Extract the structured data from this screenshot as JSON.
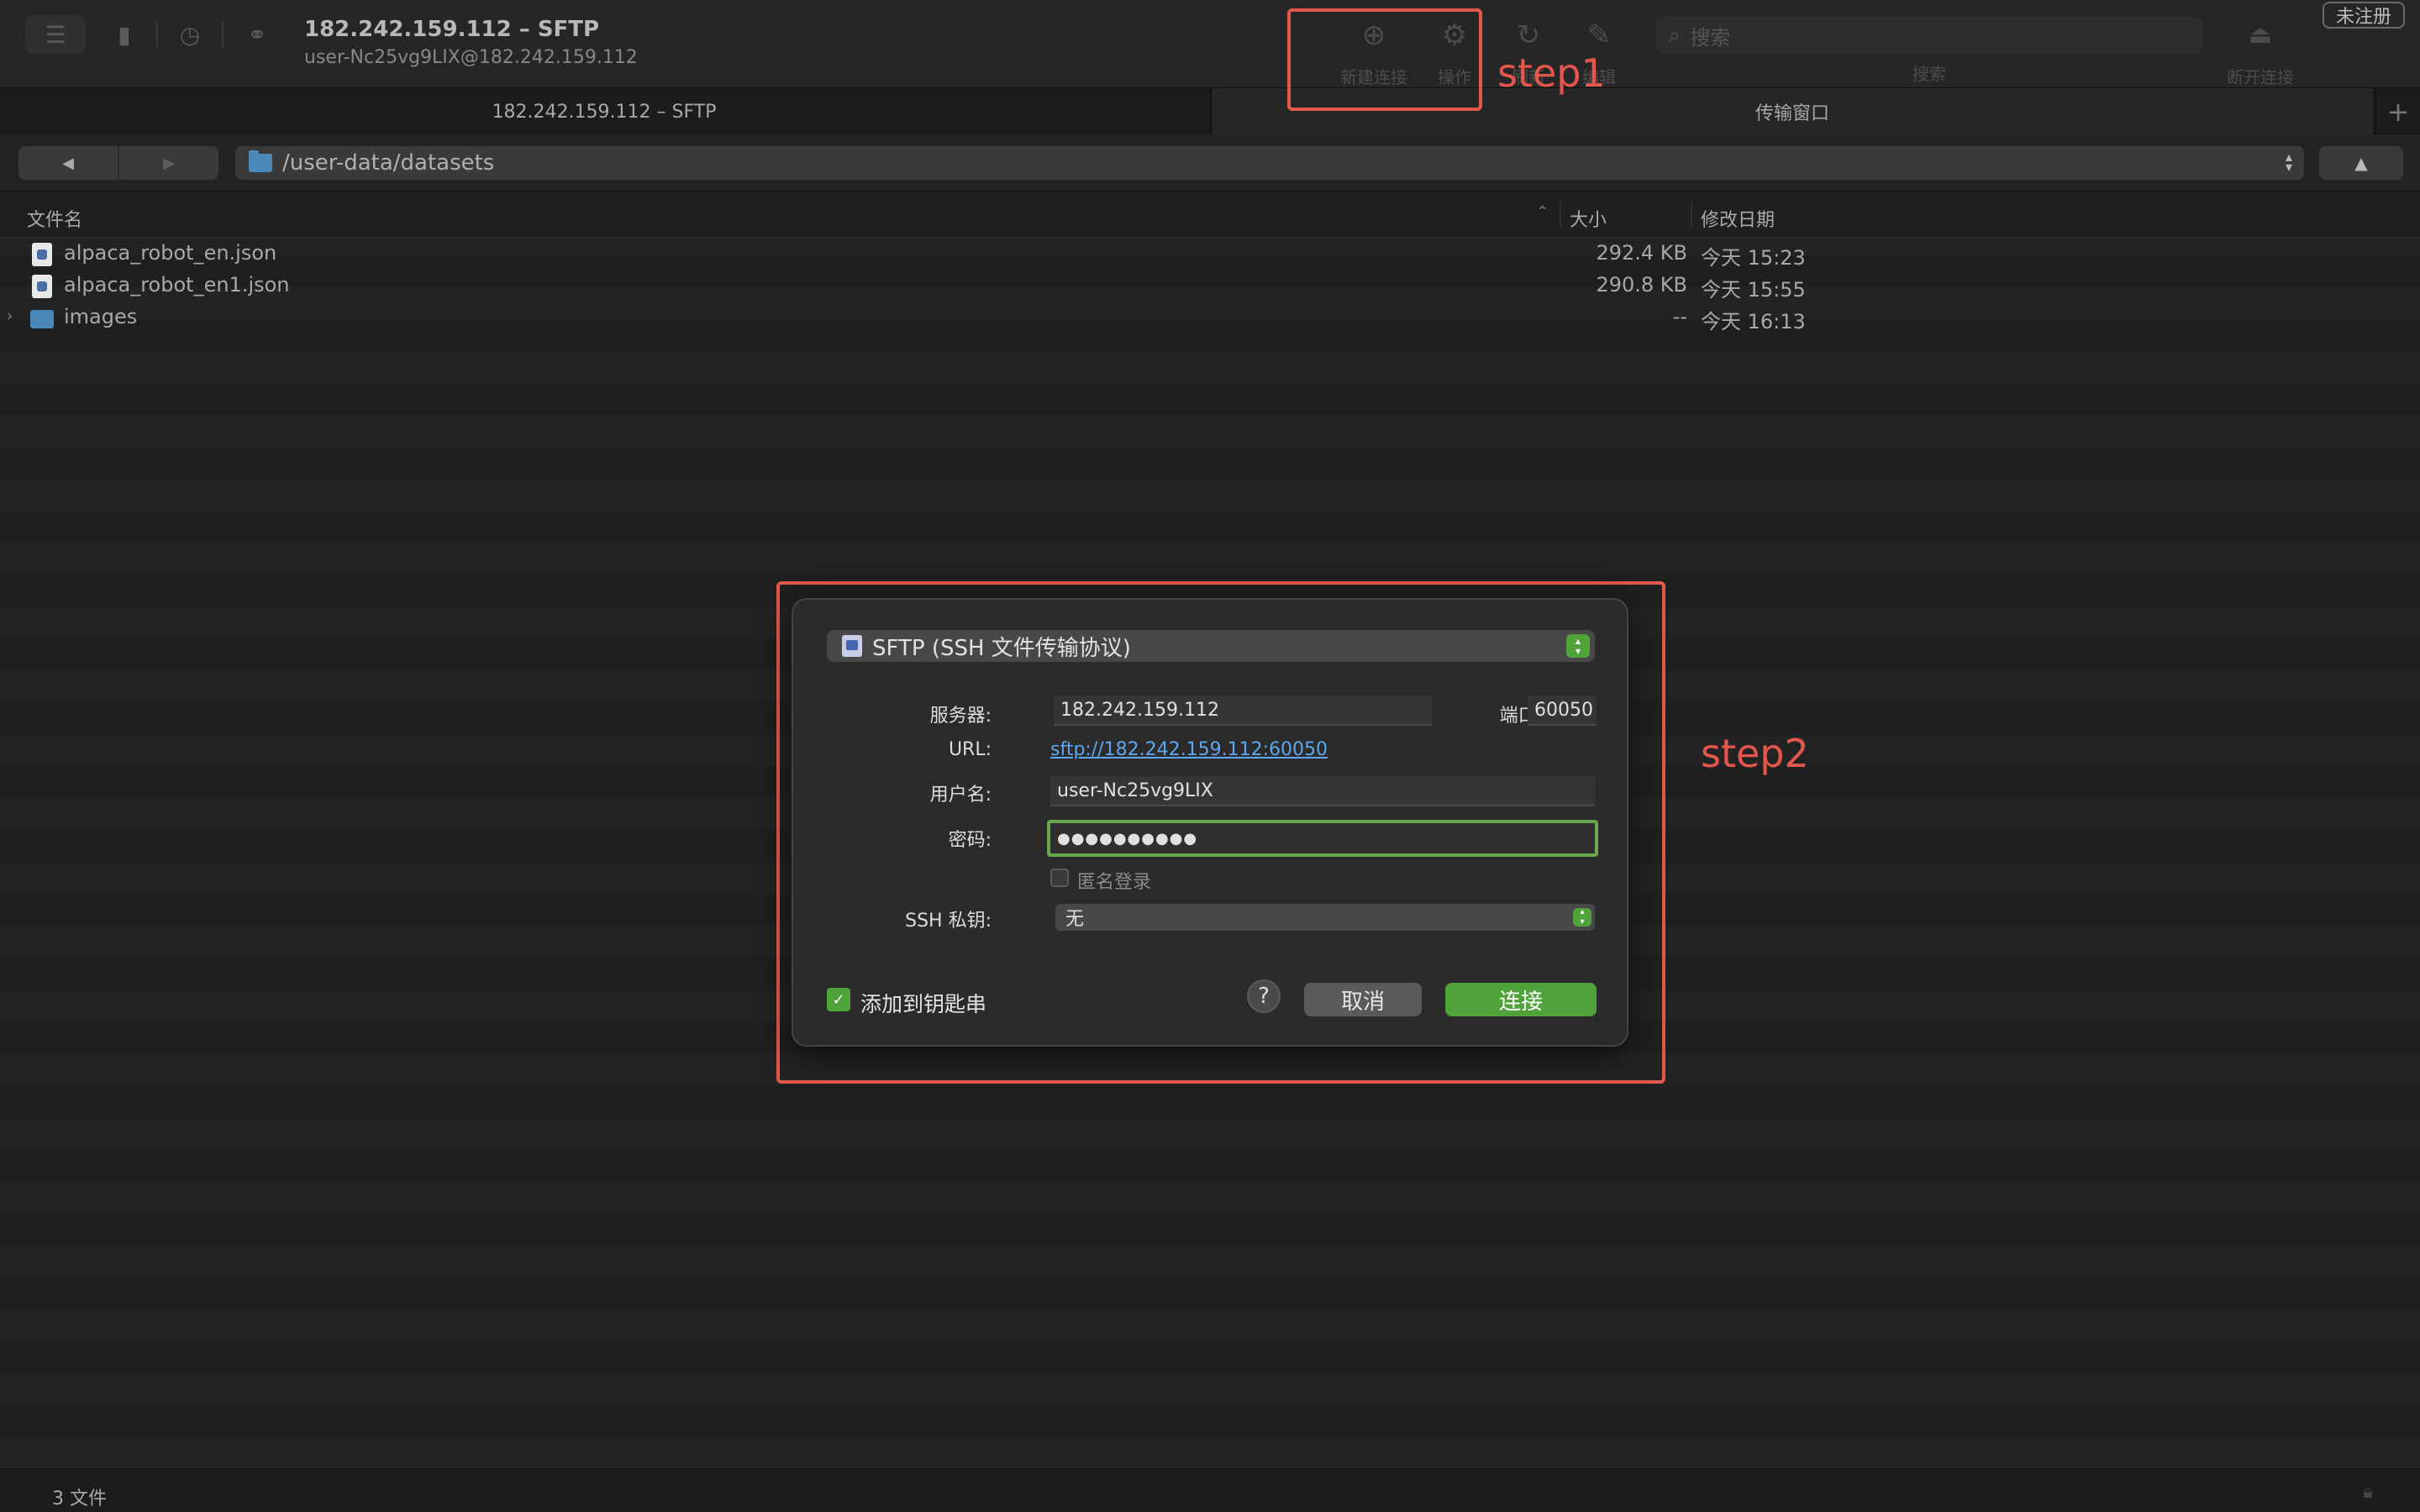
{
  "window": {
    "title": "182.242.159.112 – SFTP",
    "subtitle": "user-Nc25vg9LIX@182.242.159.112",
    "unregistered": "未注册"
  },
  "toolbar": {
    "new_connection": "新建连接",
    "actions": "操作",
    "refresh": "刷新",
    "edit": "编辑",
    "search_placeholder": "搜索",
    "search_label": "搜索",
    "disconnect": "断开连接"
  },
  "tabs": [
    {
      "label": "182.242.159.112 – SFTP"
    },
    {
      "label": "传输窗口"
    }
  ],
  "nav": {
    "path": "/user-data/datasets"
  },
  "columns": {
    "name": "文件名",
    "size": "大小",
    "modified": "修改日期"
  },
  "files": [
    {
      "name": "alpaca_robot_en.json",
      "size": "292.4 KB",
      "modified": "今天 15:23",
      "kind": "json"
    },
    {
      "name": "alpaca_robot_en1.json",
      "size": "290.8 KB",
      "modified": "今天 15:55",
      "kind": "json"
    },
    {
      "name": "images",
      "size": "--",
      "modified": "今天 16:13",
      "kind": "folder"
    }
  ],
  "status": {
    "count": "3 文件"
  },
  "annotations": {
    "step1": "step1",
    "step2": "step2",
    "color": "#e5574c"
  },
  "dialog": {
    "protocol": "SFTP (SSH 文件传输协议)",
    "server_label": "服务器:",
    "server_value": "182.242.159.112",
    "port_label": "端口:",
    "port_value": "60050",
    "url_label": "URL:",
    "url_value": "sftp://182.242.159.112:60050",
    "username_label": "用户名:",
    "username_value": "user-Nc25vg9LIX",
    "password_label": "密码:",
    "password_value": "●●●●●●●●●●",
    "anonymous_label": "匿名登录",
    "ssh_key_label": "SSH 私钥:",
    "ssh_key_value": "无",
    "keychain_label": "添加到钥匙串",
    "help": "?",
    "cancel": "取消",
    "connect": "连接",
    "accent": "#4fa33a"
  }
}
